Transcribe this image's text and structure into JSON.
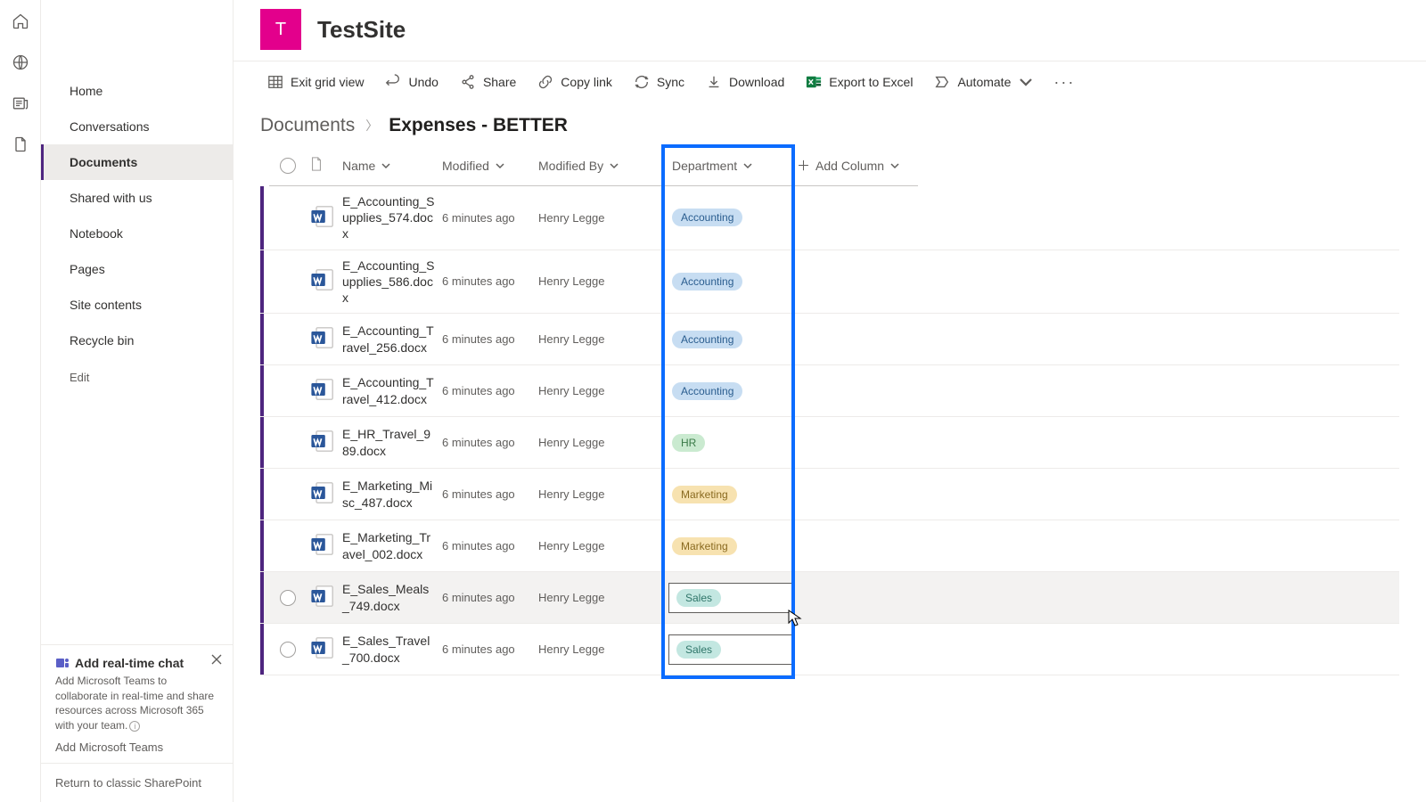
{
  "site": {
    "initial": "T",
    "name": "TestSite"
  },
  "nav": {
    "items": [
      {
        "label": "Home"
      },
      {
        "label": "Conversations"
      },
      {
        "label": "Documents",
        "active": true
      },
      {
        "label": "Shared with us"
      },
      {
        "label": "Notebook"
      },
      {
        "label": "Pages"
      },
      {
        "label": "Site contents"
      },
      {
        "label": "Recycle bin"
      }
    ],
    "edit": "Edit"
  },
  "teamsCard": {
    "title": "Add real-time chat",
    "desc": "Add Microsoft Teams to collaborate in real-time and share resources across Microsoft 365 with your team.",
    "addLink": "Add Microsoft Teams"
  },
  "returnLink": "Return to classic SharePoint",
  "toolbar": {
    "exitGrid": "Exit grid view",
    "undo": "Undo",
    "share": "Share",
    "copyLink": "Copy link",
    "sync": "Sync",
    "download": "Download",
    "exportExcel": "Export to Excel",
    "automate": "Automate"
  },
  "breadcrumb": {
    "root": "Documents",
    "current": "Expenses - BETTER"
  },
  "columns": {
    "name": "Name",
    "modified": "Modified",
    "modifiedBy": "Modified By",
    "department": "Department",
    "addColumn": "Add Column"
  },
  "rows": [
    {
      "name": "E_Accounting_Supplies_574.docx",
      "modified": "6 minutes ago",
      "modifiedBy": "Henry Legge",
      "dept": "Accounting"
    },
    {
      "name": "E_Accounting_Supplies_586.docx",
      "modified": "6 minutes ago",
      "modifiedBy": "Henry Legge",
      "dept": "Accounting"
    },
    {
      "name": "E_Accounting_Travel_256.docx",
      "modified": "6 minutes ago",
      "modifiedBy": "Henry Legge",
      "dept": "Accounting"
    },
    {
      "name": "E_Accounting_Travel_412.docx",
      "modified": "6 minutes ago",
      "modifiedBy": "Henry Legge",
      "dept": "Accounting"
    },
    {
      "name": "E_HR_Travel_989.docx",
      "modified": "6 minutes ago",
      "modifiedBy": "Henry Legge",
      "dept": "HR"
    },
    {
      "name": "E_Marketing_Misc_487.docx",
      "modified": "6 minutes ago",
      "modifiedBy": "Henry Legge",
      "dept": "Marketing"
    },
    {
      "name": "E_Marketing_Travel_002.docx",
      "modified": "6 minutes ago",
      "modifiedBy": "Henry Legge",
      "dept": "Marketing"
    },
    {
      "name": "E_Sales_Meals_749.docx",
      "modified": "6 minutes ago",
      "modifiedBy": "Henry Legge",
      "dept": "Sales",
      "hovered": true,
      "editing": true,
      "showSel": true
    },
    {
      "name": "E_Sales_Travel_700.docx",
      "modified": "6 minutes ago",
      "modifiedBy": "Henry Legge",
      "dept": "Sales",
      "editing": true,
      "showSel": true
    }
  ]
}
